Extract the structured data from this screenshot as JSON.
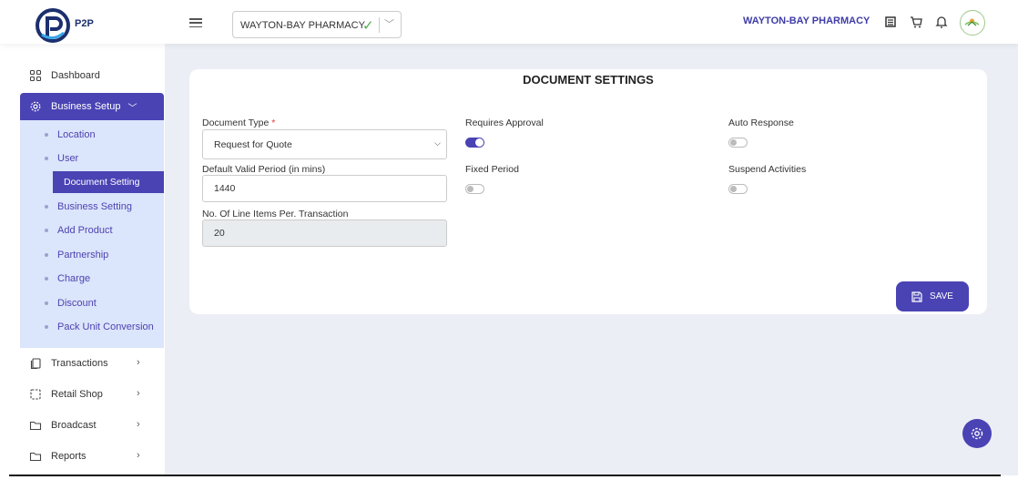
{
  "header": {
    "brand": "P2P",
    "store_selector": {
      "value": "WAYTON-BAY PHARMACY"
    },
    "store_name": "WAYTON-BAY PHARMACY",
    "icons": [
      "list-icon",
      "cart-icon",
      "bell-icon",
      "avatar"
    ]
  },
  "sidebar": {
    "items": [
      {
        "label": "Dashboard",
        "icon": "grid-icon"
      },
      {
        "label": "Business Setup",
        "icon": "gear-icon",
        "expanded": true
      },
      {
        "label": "Transactions",
        "icon": "copy-icon"
      },
      {
        "label": "Retail Shop",
        "icon": "frame-icon"
      },
      {
        "label": "Broadcast",
        "icon": "folder-icon"
      },
      {
        "label": "Reports",
        "icon": "folder-icon"
      }
    ],
    "submenu": [
      {
        "label": "Location"
      },
      {
        "label": "User"
      },
      {
        "label": "Document Setting",
        "active": true
      },
      {
        "label": "Business Setting"
      },
      {
        "label": "Add Product"
      },
      {
        "label": "Partnership"
      },
      {
        "label": "Charge"
      },
      {
        "label": "Discount"
      },
      {
        "label": "Pack Unit Conversion"
      }
    ]
  },
  "form": {
    "title": "DOCUMENT SETTINGS",
    "document_type": {
      "label": "Document Type",
      "required_mark": "*",
      "value": "Request for Quote"
    },
    "default_valid_period": {
      "label": "Default Valid Period (in mins)",
      "value": "1440"
    },
    "line_items": {
      "label": "No. Of Line Items Per. Transaction",
      "value": "20"
    },
    "requires_approval": {
      "label": "Requires Approval",
      "on": true
    },
    "fixed_period": {
      "label": "Fixed Period",
      "on": false
    },
    "auto_response": {
      "label": "Auto Response",
      "on": false
    },
    "suspend_activities": {
      "label": "Suspend Activities",
      "on": false
    },
    "save_label": "SAVE"
  },
  "colors": {
    "accent": "#4a43b4",
    "submenu_bg": "#dbe5fb",
    "content_bg": "#eceef6"
  }
}
